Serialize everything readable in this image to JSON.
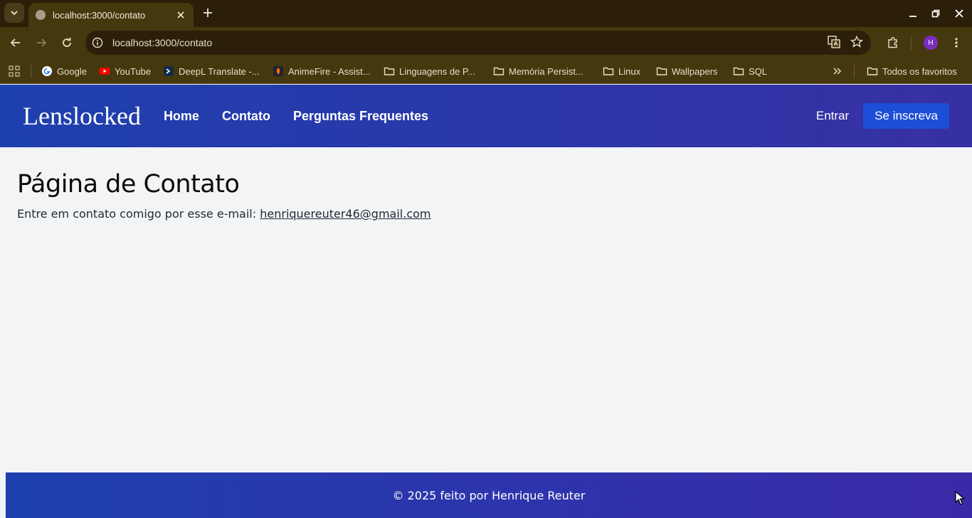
{
  "browser": {
    "tab_title": "localhost:3000/contato",
    "url": "localhost:3000/contato",
    "profile_initial": "H",
    "bookmarks": [
      {
        "label": "Google",
        "icon": "google-icon"
      },
      {
        "label": "YouTube",
        "icon": "youtube-icon"
      },
      {
        "label": "DeepL Translate -...",
        "icon": "deepl-icon"
      },
      {
        "label": "AnimeFire - Assist...",
        "icon": "animefire-icon"
      },
      {
        "label": "Linguagens de P...",
        "icon": "folder-icon"
      },
      {
        "label": "Memória Persist...",
        "icon": "folder-icon"
      },
      {
        "label": "Linux",
        "icon": "folder-icon"
      },
      {
        "label": "Wallpapers",
        "icon": "folder-icon"
      },
      {
        "label": "SQL",
        "icon": "folder-icon"
      }
    ],
    "all_bookmarks_label": "Todos os favoritos"
  },
  "site": {
    "brand": "Lenslocked",
    "nav": {
      "home": "Home",
      "contact": "Contato",
      "faq": "Perguntas Frequentes"
    },
    "login_label": "Entrar",
    "signup_label": "Se inscreva",
    "colors": {
      "header_start": "#1e40af",
      "header_end": "#3730a3",
      "signup_bg": "#1d4ed8",
      "page_bg": "#f3f4f6"
    }
  },
  "main": {
    "heading": "Página de Contato",
    "contact_text": "Entre em contato comigo por esse e-mail: ",
    "email": "henriquereuter46@gmail.com"
  },
  "footer": {
    "text": "© 2025 feito por Henrique Reuter"
  }
}
